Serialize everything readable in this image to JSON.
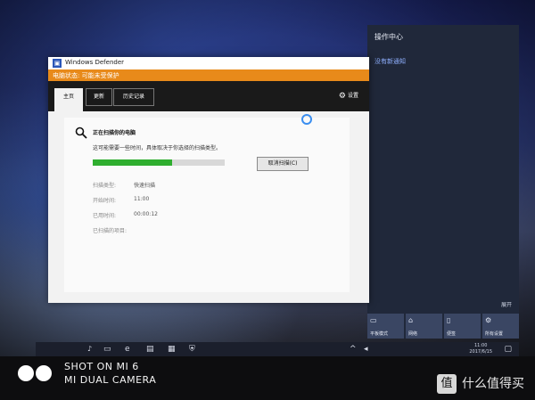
{
  "action_center": {
    "title": "操作中心",
    "empty_text": "没有新通知",
    "collapse": "展开",
    "quick_actions": [
      {
        "label": "平板模式",
        "icon": "tablet-icon"
      },
      {
        "label": "网络",
        "icon": "network-icon"
      },
      {
        "label": "便签",
        "icon": "note-icon"
      },
      {
        "label": "所有设置",
        "icon": "gear-icon"
      }
    ]
  },
  "window": {
    "title": "Windows Defender",
    "status": "电脑状态: 可能未受保护",
    "tabs": [
      {
        "label": "主页",
        "active": true
      },
      {
        "label": "更新",
        "active": false
      },
      {
        "label": "历史记录",
        "active": false
      }
    ],
    "settings_label": "设置",
    "scan": {
      "title": "正在扫描你的电脑",
      "description": "这可能需要一些时间，具体取决于你选择的扫描类型。",
      "progress": 0.6,
      "cancel_label": "取消扫描(C)",
      "details": [
        {
          "label": "扫描类型:",
          "value": "快速扫描"
        },
        {
          "label": "开始时间:",
          "value": "11:00"
        },
        {
          "label": "已用时间:",
          "value": "00:00:12"
        },
        {
          "label": "已扫描的项目:",
          "value": ""
        }
      ]
    }
  },
  "taskbar": {
    "time": "11:00",
    "date": "2017/6/15"
  },
  "photo": {
    "line1": "SHOT ON MI 6",
    "line2": "MI DUAL CAMERA",
    "watermark": "什么值得买",
    "watermark_badge": "值"
  },
  "colors": {
    "status_orange": "#e88a1a",
    "progress_green": "#2fae2f",
    "accent_blue": "#3a8ef0"
  }
}
